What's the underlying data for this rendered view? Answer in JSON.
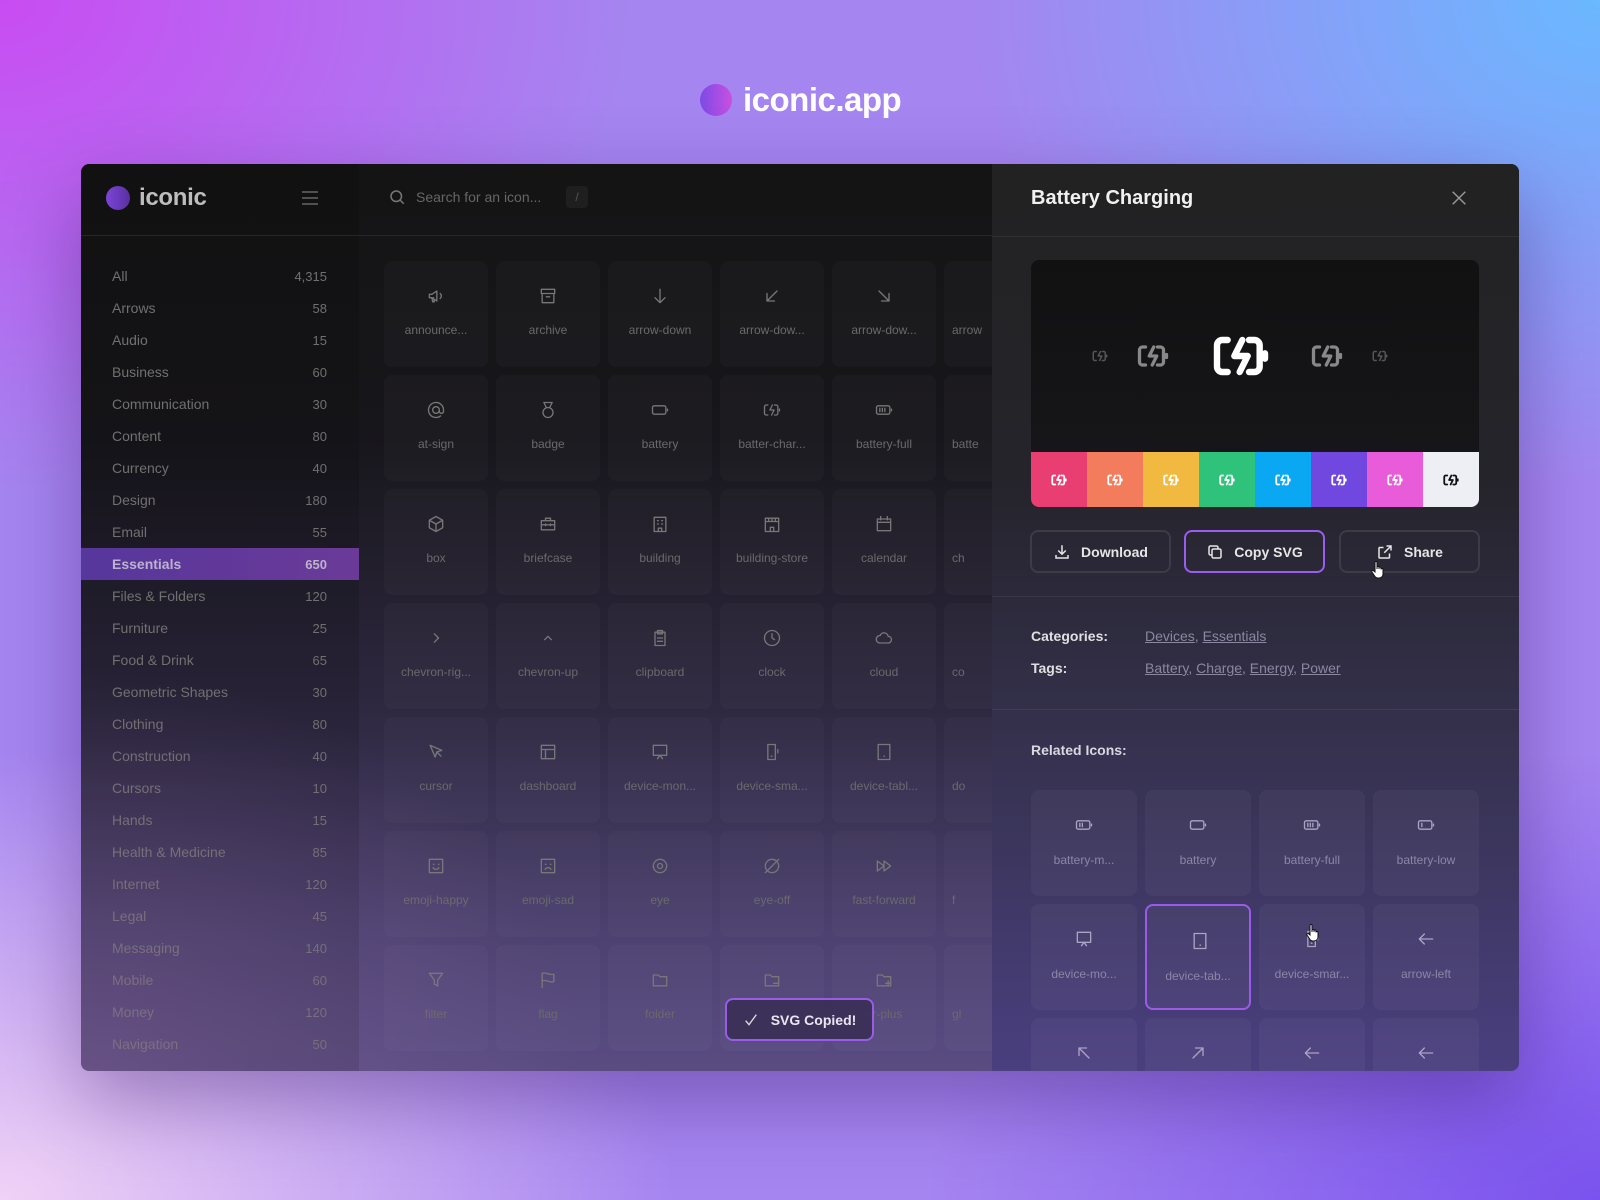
{
  "brand": {
    "name": "iconic.app"
  },
  "app": {
    "logo_text": "iconic"
  },
  "search": {
    "placeholder": "Search for an icon...",
    "shortcut": "/"
  },
  "sidebar": {
    "active": "Essentials",
    "items": [
      {
        "label": "All",
        "count": "4,315"
      },
      {
        "label": "Arrows",
        "count": "58"
      },
      {
        "label": "Audio",
        "count": "15"
      },
      {
        "label": "Business",
        "count": "60"
      },
      {
        "label": "Communication",
        "count": "30"
      },
      {
        "label": "Content",
        "count": "80"
      },
      {
        "label": "Currency",
        "count": "40"
      },
      {
        "label": "Design",
        "count": "180"
      },
      {
        "label": "Email",
        "count": "55"
      },
      {
        "label": "Essentials",
        "count": "650"
      },
      {
        "label": "Files & Folders",
        "count": "120"
      },
      {
        "label": "Furniture",
        "count": "25"
      },
      {
        "label": "Food & Drink",
        "count": "65"
      },
      {
        "label": "Geometric Shapes",
        "count": "30"
      },
      {
        "label": "Clothing",
        "count": "80"
      },
      {
        "label": "Construction",
        "count": "40"
      },
      {
        "label": "Cursors",
        "count": "10"
      },
      {
        "label": "Hands",
        "count": "15"
      },
      {
        "label": "Health & Medicine",
        "count": "85"
      },
      {
        "label": "Internet",
        "count": "120"
      },
      {
        "label": "Legal",
        "count": "45"
      },
      {
        "label": "Messaging",
        "count": "140"
      },
      {
        "label": "Mobile",
        "count": "60"
      },
      {
        "label": "Money",
        "count": "120"
      },
      {
        "label": "Navigation",
        "count": "50"
      }
    ]
  },
  "grid": {
    "rows": [
      [
        {
          "label": "announce...",
          "icon": "announcement"
        },
        {
          "label": "archive",
          "icon": "archive"
        },
        {
          "label": "arrow-down",
          "icon": "arrow-down"
        },
        {
          "label": "arrow-dow...",
          "icon": "arrow-down-left"
        },
        {
          "label": "arrow-dow...",
          "icon": "arrow-down-right"
        },
        {
          "label": "arrow",
          "icon": ""
        }
      ],
      [
        {
          "label": "at-sign",
          "icon": "at-sign"
        },
        {
          "label": "badge",
          "icon": "badge"
        },
        {
          "label": "battery",
          "icon": "battery"
        },
        {
          "label": "batter-char...",
          "icon": "battery-charging"
        },
        {
          "label": "battery-full",
          "icon": "battery-full"
        },
        {
          "label": "batte",
          "icon": ""
        }
      ],
      [
        {
          "label": "box",
          "icon": "box"
        },
        {
          "label": "briefcase",
          "icon": "briefcase"
        },
        {
          "label": "building",
          "icon": "building"
        },
        {
          "label": "building-store",
          "icon": "building-store"
        },
        {
          "label": "calendar",
          "icon": "calendar"
        },
        {
          "label": "ch",
          "icon": ""
        }
      ],
      [
        {
          "label": "chevron-rig...",
          "icon": "chevron-right"
        },
        {
          "label": "chevron-up",
          "icon": "chevron-up"
        },
        {
          "label": "clipboard",
          "icon": "clipboard"
        },
        {
          "label": "clock",
          "icon": "clock"
        },
        {
          "label": "cloud",
          "icon": "cloud"
        },
        {
          "label": "co",
          "icon": ""
        }
      ],
      [
        {
          "label": "cursor",
          "icon": "cursor"
        },
        {
          "label": "dashboard",
          "icon": "dashboard"
        },
        {
          "label": "device-mon...",
          "icon": "device-monitor"
        },
        {
          "label": "device-sma...",
          "icon": "device-smartphone"
        },
        {
          "label": "device-tabl...",
          "icon": "device-tablet"
        },
        {
          "label": "do",
          "icon": ""
        }
      ],
      [
        {
          "label": "emoji-happy",
          "icon": "emoji-happy"
        },
        {
          "label": "emoji-sad",
          "icon": "emoji-sad"
        },
        {
          "label": "eye",
          "icon": "eye"
        },
        {
          "label": "eye-off",
          "icon": "eye-off"
        },
        {
          "label": "fast-forward",
          "icon": "fast-forward"
        },
        {
          "label": "f",
          "icon": ""
        }
      ],
      [
        {
          "label": "filter",
          "icon": "filter"
        },
        {
          "label": "flag",
          "icon": "flag"
        },
        {
          "label": "folder",
          "icon": "folder"
        },
        {
          "label": "",
          "icon": "folder-minus"
        },
        {
          "label": "er-plus",
          "icon": "folder-plus"
        },
        {
          "label": "gl",
          "icon": ""
        }
      ]
    ]
  },
  "toast": {
    "label": "SVG Copied!",
    "icon": "check-icon"
  },
  "detail": {
    "title": "Battery Charging",
    "icon": "battery-charging",
    "swatches": [
      "#e83e72",
      "#f27c5b",
      "#f2b941",
      "#2fc27a",
      "#0aa7f2",
      "#7048e0",
      "#e85bd9",
      "#eeeef5"
    ],
    "buttons": {
      "download": "Download",
      "copy": "Copy SVG",
      "share": "Share"
    },
    "categories_label": "Categories:",
    "categories": [
      "Devices",
      "Essentials"
    ],
    "tags_label": "Tags:",
    "tags": [
      "Battery",
      "Charge",
      "Energy",
      "Power"
    ],
    "related_label": "Related Icons:",
    "related": [
      {
        "label": "battery-m...",
        "icon": "battery-medium"
      },
      {
        "label": "battery",
        "icon": "battery"
      },
      {
        "label": "battery-full",
        "icon": "battery-full"
      },
      {
        "label": "battery-low",
        "icon": "battery-low"
      },
      {
        "label": "device-mo...",
        "icon": "device-monitor"
      },
      {
        "label": "device-tab...",
        "icon": "device-tablet",
        "selected": true
      },
      {
        "label": "device-smar...",
        "icon": "device-smartphone"
      },
      {
        "label": "arrow-left",
        "icon": "arrow-left"
      },
      {
        "label": "",
        "icon": "arrow-up-left"
      },
      {
        "label": "",
        "icon": "arrow-up-right"
      },
      {
        "label": "",
        "icon": "arrow-left"
      },
      {
        "label": "",
        "icon": "arrow-left"
      }
    ]
  },
  "colors": {
    "accent": "#9a5ce8",
    "active_item": "#5e3a9c"
  }
}
